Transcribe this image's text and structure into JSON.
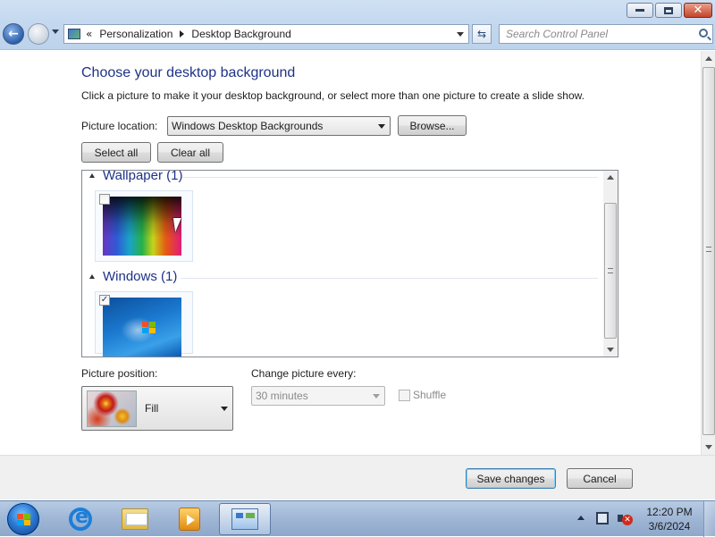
{
  "window": {
    "minimize": "minimize",
    "maximize": "restore",
    "close": "close"
  },
  "address": {
    "chevron": "«",
    "breadcrumbs": [
      "Personalization",
      "Desktop Background"
    ]
  },
  "search": {
    "placeholder": "Search Control Panel"
  },
  "page": {
    "heading": "Choose your desktop background",
    "subtext": "Click a picture to make it your desktop background, or select more than one picture to create a slide show."
  },
  "picture_location": {
    "label": "Picture location:",
    "value": "Windows Desktop Backgrounds"
  },
  "buttons": {
    "browse": "Browse...",
    "select_all": "Select all",
    "clear_all": "Clear all",
    "save": "Save changes",
    "cancel": "Cancel"
  },
  "groups": [
    {
      "title": "Wallpaper (1)",
      "checked": false
    },
    {
      "title": "Windows (1)",
      "checked": true
    }
  ],
  "picture_position": {
    "label": "Picture position:",
    "value": "Fill"
  },
  "change_picture": {
    "label": "Change picture every:",
    "value": "30 minutes"
  },
  "shuffle": {
    "label": "Shuffle",
    "checked": false
  },
  "taskbar": {
    "apps": [
      "internet-explorer",
      "windows-explorer",
      "media-player",
      "control-panel"
    ],
    "clock_time": "12:20 PM",
    "clock_date": "3/6/2024"
  }
}
